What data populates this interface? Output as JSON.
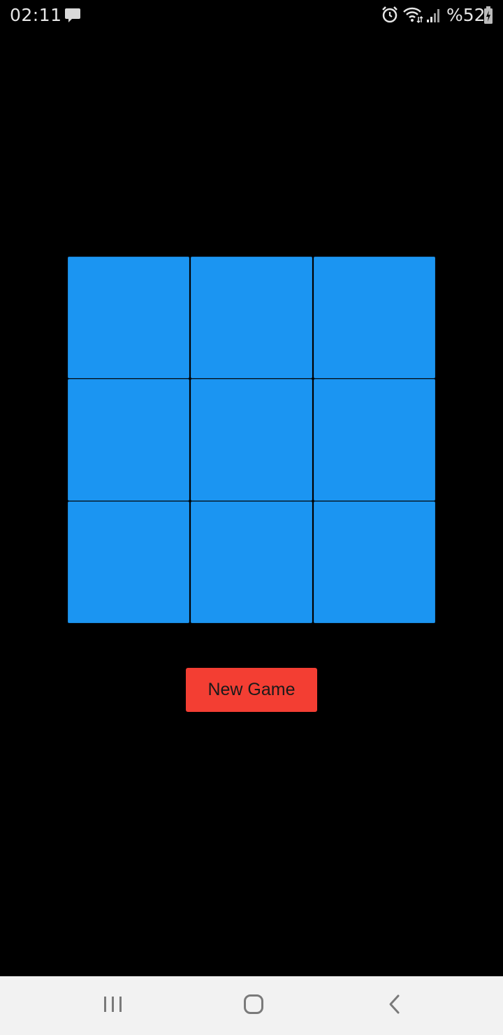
{
  "status_bar": {
    "time": "02:11",
    "battery_text": "%52",
    "icons": [
      "message-icon",
      "alarm-icon",
      "wifi-icon",
      "signal-icon",
      "battery-icon"
    ]
  },
  "board": {
    "cells": [
      "",
      "",
      "",
      "",
      "",
      "",
      "",
      "",
      ""
    ],
    "cell_color": "#1b95f2"
  },
  "actions": {
    "new_game_label": "New Game",
    "button_color": "#f33e33"
  },
  "nav_bar": {
    "buttons": [
      "recents-icon",
      "home-icon",
      "back-icon"
    ]
  }
}
